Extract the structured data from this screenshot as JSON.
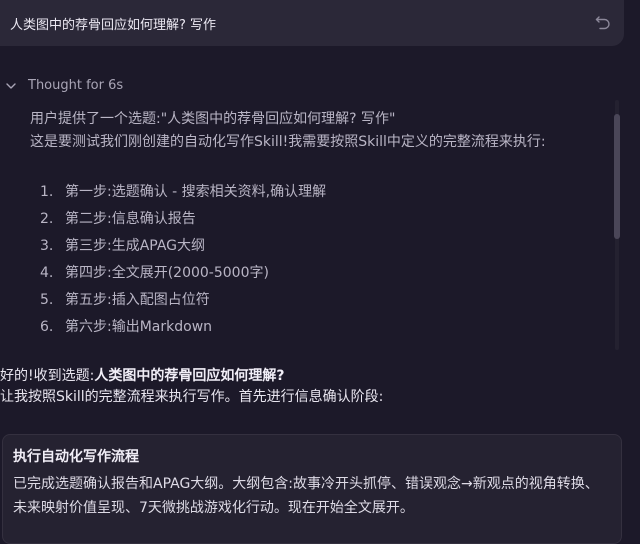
{
  "user_message": {
    "text": "人类图中的荐骨回应如何理解? 写作",
    "undo_icon": "undo-icon"
  },
  "thought": {
    "label": "Thought for 6s",
    "toggle_icon": "chevron-down-icon",
    "paragraph1": "用户提供了一个选题:\"人类图中的荐骨回应如何理解? 写作\"",
    "paragraph2": "这是要测试我们刚创建的自动化写作Skill!我需要按照Skill中定义的完整流程来执行:",
    "steps": [
      {
        "num": "1.",
        "text": "第一步:选题确认 - 搜索相关资料,确认理解"
      },
      {
        "num": "2.",
        "text": "第二步:信息确认报告"
      },
      {
        "num": "3.",
        "text": "第三步:生成APAG大纲"
      },
      {
        "num": "4.",
        "text": "第四步:全文展开(2000-5000字)"
      },
      {
        "num": "5.",
        "text": "第五步:插入配图占位符"
      },
      {
        "num": "6.",
        "text": "第六步:输出Markdown"
      }
    ]
  },
  "reply": {
    "prefix": "好的!收到选题:",
    "topic": "人类图中的荐骨回应如何理解?",
    "line2": "让我按照Skill的完整流程来执行写作。首先进行信息确认阶段:"
  },
  "card": {
    "title": "执行自动化写作流程",
    "body": "已完成选题确认报告和APAG大纲。大纲包含:故事冷开头抓停、错误观念→新观点的视角转换、未来映射价值呈现、7天微挑战游戏化行动。现在开始全文展开。"
  }
}
